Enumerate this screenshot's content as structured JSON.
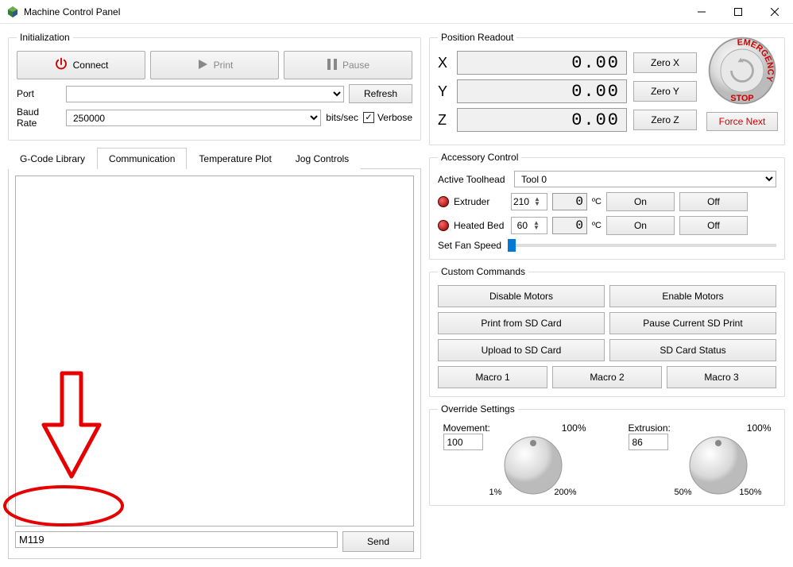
{
  "window": {
    "title": "Machine Control Panel"
  },
  "init": {
    "legend": "Initialization",
    "connect": "Connect",
    "print": "Print",
    "pause": "Pause",
    "port_label": "Port",
    "port_value": "",
    "refresh": "Refresh",
    "baud_label": "Baud Rate",
    "baud_value": "250000",
    "baud_unit": "bits/sec",
    "verbose": "Verbose"
  },
  "tabs": {
    "items": [
      "G-Code Library",
      "Communication",
      "Temperature Plot",
      "Jog Controls"
    ],
    "active": 1,
    "command_value": "M119",
    "send": "Send"
  },
  "position": {
    "legend": "Position Readout",
    "x_label": "X",
    "x_value": "0.00",
    "zero_x": "Zero X",
    "y_label": "Y",
    "y_value": "0.00",
    "zero_y": "Zero Y",
    "z_label": "Z",
    "z_value": "0.00",
    "zero_z": "Zero Z"
  },
  "estop": {
    "force_next": "Force Next"
  },
  "accessory": {
    "legend": "Accessory Control",
    "active_toolhead_label": "Active Toolhead",
    "active_toolhead_value": "Tool 0",
    "extruder_label": "Extruder",
    "extruder_set": "210",
    "extruder_actual": "0",
    "bed_label": "Heated Bed",
    "bed_set": "60",
    "bed_actual": "0",
    "deg": "ºC",
    "on": "On",
    "off": "Off",
    "fan_label": "Set Fan Speed"
  },
  "custom": {
    "legend": "Custom Commands",
    "disable": "Disable Motors",
    "enable": "Enable Motors",
    "print_sd": "Print from SD Card",
    "pause_sd": "Pause Current SD Print",
    "upload_sd": "Upload to SD Card",
    "status_sd": "SD Card Status",
    "macro1": "Macro 1",
    "macro2": "Macro 2",
    "macro3": "Macro 3"
  },
  "override": {
    "legend": "Override Settings",
    "movement_label": "Movement:",
    "movement_pct": "100%",
    "movement_val": "100",
    "movement_min": "1%",
    "movement_max": "200%",
    "extrusion_label": "Extrusion:",
    "extrusion_pct": "100%",
    "extrusion_val": "86",
    "extrusion_min": "50%",
    "extrusion_max": "150%"
  }
}
